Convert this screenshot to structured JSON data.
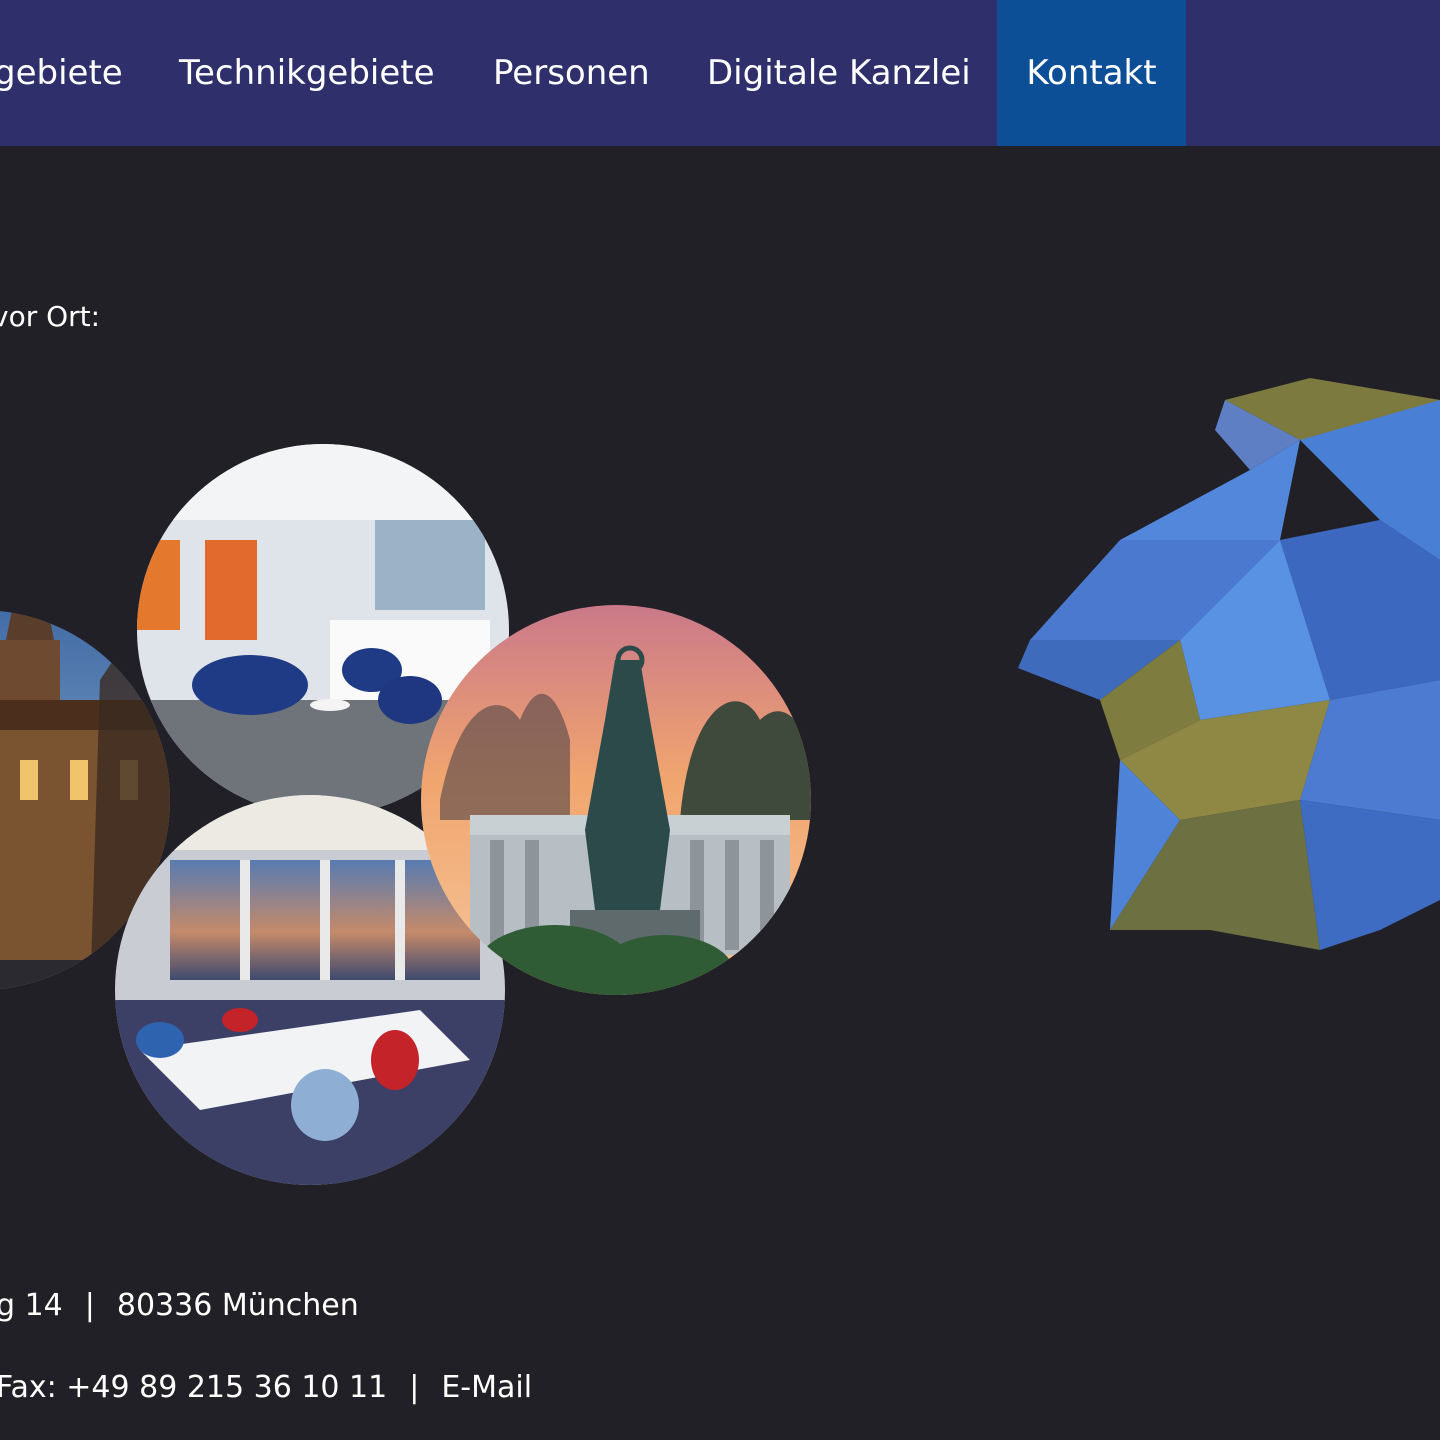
{
  "nav": {
    "items": [
      {
        "label": "gebiete"
      },
      {
        "label": "Technikgebiete"
      },
      {
        "label": "Personen"
      },
      {
        "label": "Digitale Kanzlei"
      },
      {
        "label": "Kontakt",
        "active": true
      }
    ],
    "background": "#2e2f6b",
    "active_background": "#0d4f96"
  },
  "main": {
    "intro_text": "vor Ort:"
  },
  "footer": {
    "address_street": "g 14",
    "separator": "|",
    "address_city": "80336 München",
    "fax": "Fax: +49 89 215 36 10 11",
    "email_label": "E-Mail"
  },
  "colors": {
    "page_background": "#212026",
    "lion_blue": "#4a7fd6",
    "lion_olive": "#7c7a3e"
  },
  "icons": {
    "lion": "lion-logo-icon"
  }
}
